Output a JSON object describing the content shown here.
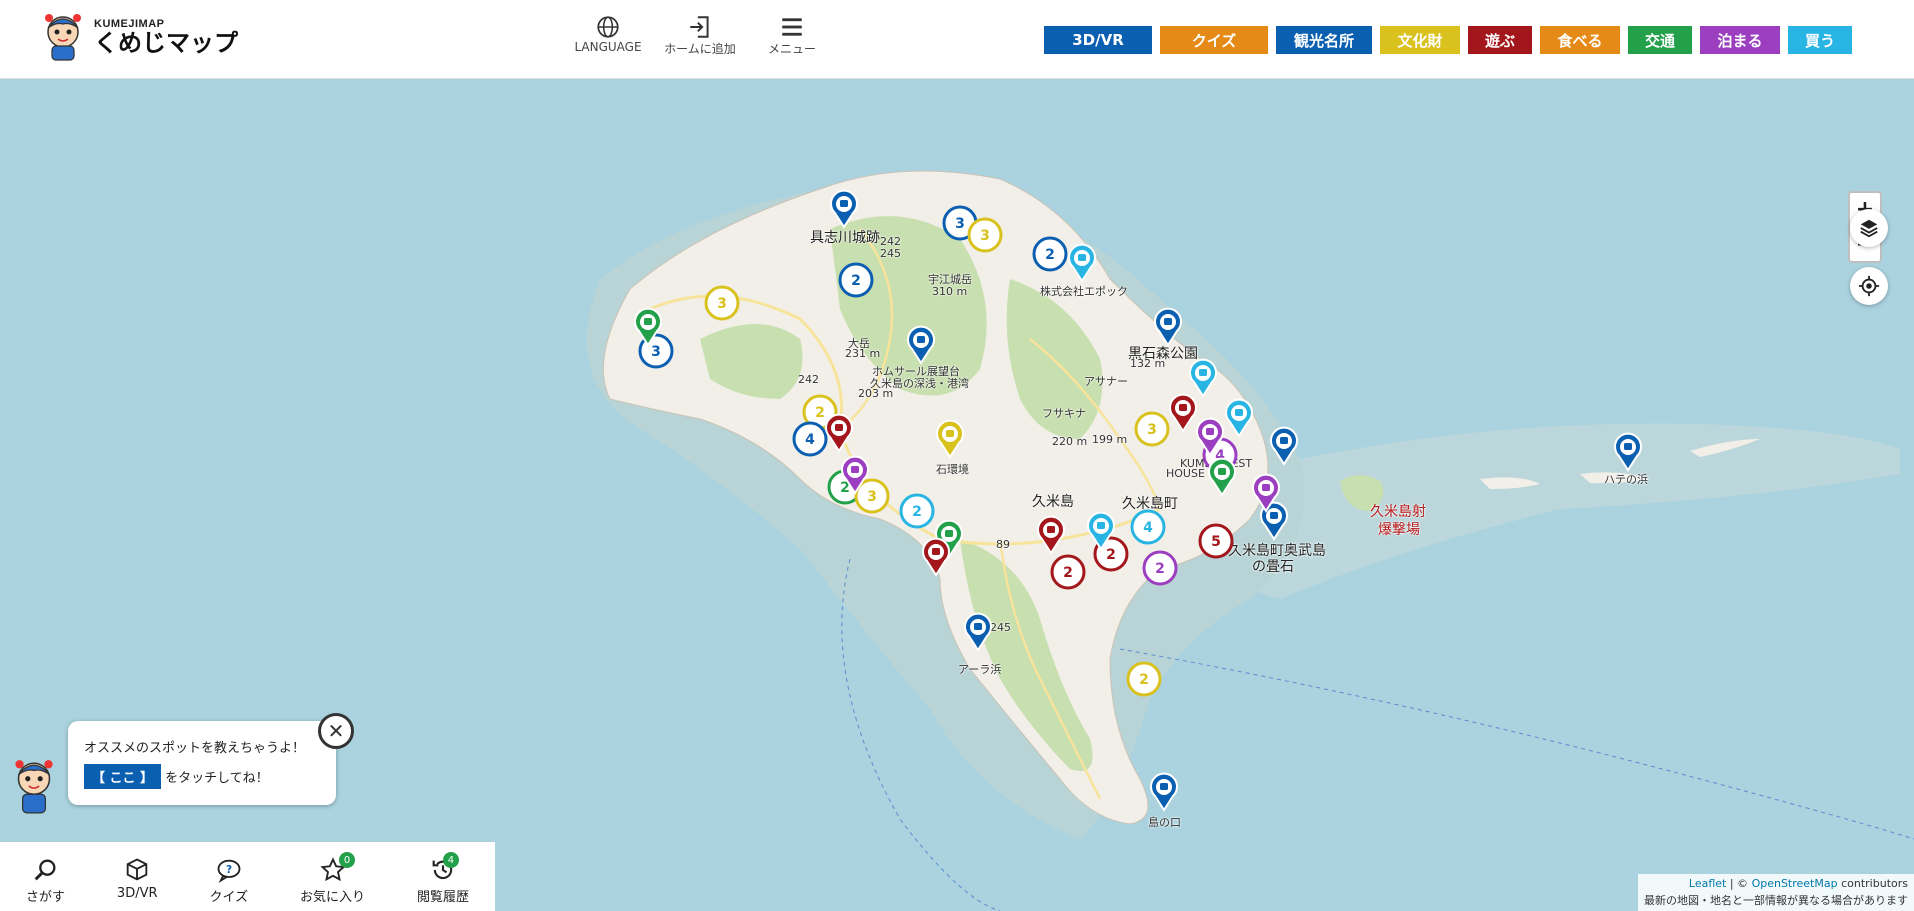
{
  "header": {
    "logo_small": "KUMEJIMAP",
    "logo_big": "くめじマップ",
    "tools": [
      {
        "label": "LANGUAGE",
        "icon": "globe-icon"
      },
      {
        "label": "ホームに追加",
        "icon": "add-to-home-icon"
      },
      {
        "label": "メニュー",
        "icon": "hamburger-menu-icon"
      }
    ],
    "categories": [
      {
        "label": "3D/VR",
        "color": "#0b5fb1"
      },
      {
        "label": "クイズ",
        "color": "#e68a17"
      },
      {
        "label": "観光名所",
        "color": "#0b5fb1"
      },
      {
        "label": "文化財",
        "color": "#d9c11e"
      },
      {
        "label": "遊ぶ",
        "color": "#a3161b"
      },
      {
        "label": "食べる",
        "color": "#e68a17"
      },
      {
        "label": "交通",
        "color": "#22a04a"
      },
      {
        "label": "泊まる",
        "color": "#9b3fc0"
      },
      {
        "label": "買う",
        "color": "#29b5e3"
      }
    ]
  },
  "map": {
    "places": [
      "具志川城跡",
      "242",
      "245",
      "宇江城岳",
      "310 m",
      "株式会社エポック",
      "大岳",
      "231 m",
      "ホムサール展望台",
      "久米島の深浅・港湾",
      "203 m",
      "242",
      "黒石森公園",
      "132 m",
      "アサナー",
      "フサキナ",
      "199 m",
      "220 m",
      "久米島",
      "久米島町",
      "久米島射",
      "爆撃場",
      "ハテの浜",
      "245",
      "アーラ浜",
      "島の口",
      "KUME GUEST",
      "HOUSE",
      "久米島町奥武島",
      "の畳石",
      "89",
      "石環境"
    ],
    "clusters": [
      {
        "n": "3",
        "color": "#0b5fb1"
      },
      {
        "n": "3",
        "color": "#d9c11e"
      },
      {
        "n": "2",
        "color": "#0b5fb1"
      },
      {
        "n": "2",
        "color": "#0b5fb1"
      },
      {
        "n": "3",
        "color": "#d9c11e"
      },
      {
        "n": "3",
        "color": "#0b5fb1"
      },
      {
        "n": "2",
        "color": "#d9c11e"
      },
      {
        "n": "4",
        "color": "#0b5fb1"
      },
      {
        "n": "2",
        "color": "#22a04a"
      },
      {
        "n": "3",
        "color": "#d9c11e"
      },
      {
        "n": "2",
        "color": "#29b5e3"
      },
      {
        "n": "3",
        "color": "#d9c11e"
      },
      {
        "n": "4",
        "color": "#29b5e3"
      },
      {
        "n": "5",
        "color": "#a3161b"
      },
      {
        "n": "2",
        "color": "#a3161b"
      },
      {
        "n": "2",
        "color": "#a3161b"
      },
      {
        "n": "2",
        "color": "#9b3fc0"
      },
      {
        "n": "2",
        "color": "#d9c11e"
      },
      {
        "n": "4",
        "color": "#9b3fc0"
      }
    ],
    "pins": [
      {
        "color": "#0b5fb1",
        "icon": "camera-icon"
      },
      {
        "color": "#0b5fb1",
        "icon": "camera-icon"
      },
      {
        "color": "#0b5fb1",
        "icon": "camera-icon"
      },
      {
        "color": "#0b5fb1",
        "icon": "camera-icon"
      },
      {
        "color": "#0b5fb1",
        "icon": "camera-icon"
      },
      {
        "color": "#0b5fb1",
        "icon": "camera-icon"
      },
      {
        "color": "#0b5fb1",
        "icon": "camera-icon"
      },
      {
        "color": "#0b5fb1",
        "icon": "camera-icon"
      },
      {
        "color": "#29b5e3",
        "icon": "shopping-bag-icon"
      },
      {
        "color": "#29b5e3",
        "icon": "shopping-bag-icon"
      },
      {
        "color": "#29b5e3",
        "icon": "shopping-bag-icon"
      },
      {
        "color": "#29b5e3",
        "icon": "shopping-bag-icon"
      },
      {
        "color": "#22a04a",
        "icon": "car-icon"
      },
      {
        "color": "#22a04a",
        "icon": "car-icon"
      },
      {
        "color": "#22a04a",
        "icon": "car-icon"
      },
      {
        "color": "#a3161b",
        "icon": "flag-icon"
      },
      {
        "color": "#a3161b",
        "icon": "flag-icon"
      },
      {
        "color": "#a3161b",
        "icon": "flag-icon"
      },
      {
        "color": "#a3161b",
        "icon": "flag-icon"
      },
      {
        "color": "#9b3fc0",
        "icon": "bed-icon"
      },
      {
        "color": "#9b3fc0",
        "icon": "bed-icon"
      },
      {
        "color": "#9b3fc0",
        "icon": "bed-icon"
      },
      {
        "color": "#d9c11e",
        "icon": "torii-icon"
      }
    ],
    "zoom_in": "+",
    "zoom_out": "−"
  },
  "popup": {
    "line1": "オススメのスポットを教えちゃうよ！",
    "here": "【 ここ 】",
    "line2": "をタッチしてね！",
    "close": "✕"
  },
  "bottom_nav": [
    {
      "label": "さがす",
      "icon": "search-icon"
    },
    {
      "label": "3D/VR",
      "icon": "cube-3d-icon"
    },
    {
      "label": "クイズ",
      "icon": "quiz-bubble-icon"
    },
    {
      "label": "お気に入り",
      "icon": "star-icon",
      "badge": "0"
    },
    {
      "label": "閲覧履歴",
      "icon": "history-icon",
      "badge": "4"
    }
  ],
  "attribution": {
    "leaflet": "Leaflet",
    "osm_prefix": "| © ",
    "osm": "OpenStreetMap",
    "contributors": " contributors",
    "note": "最新の地図・地名と一部情報が異なる場合があります"
  }
}
